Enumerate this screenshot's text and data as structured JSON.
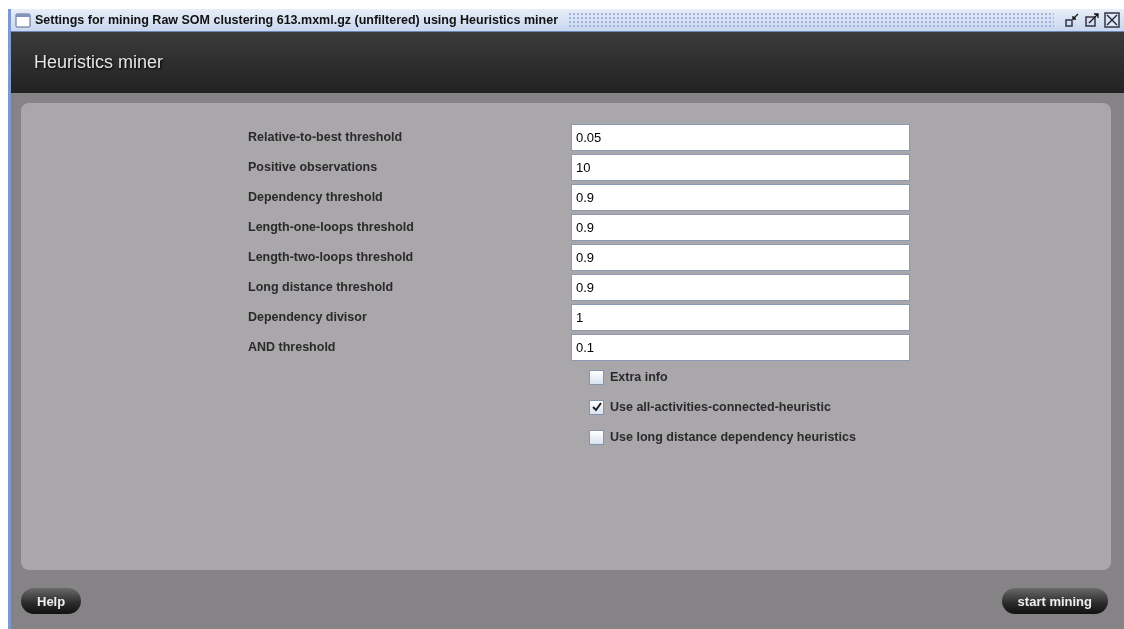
{
  "window": {
    "title": "Settings for mining Raw SOM clustering 613.mxml.gz (unfiltered) using Heuristics miner"
  },
  "header": {
    "title": "Heuristics miner"
  },
  "parameters": [
    {
      "label": "Relative-to-best threshold",
      "value": "0.05"
    },
    {
      "label": "Positive observations",
      "value": "10"
    },
    {
      "label": "Dependency threshold",
      "value": "0.9"
    },
    {
      "label": "Length-one-loops threshold",
      "value": "0.9"
    },
    {
      "label": "Length-two-loops threshold",
      "value": "0.9"
    },
    {
      "label": "Long distance threshold",
      "value": "0.9"
    },
    {
      "label": "Dependency divisor",
      "value": "1"
    },
    {
      "label": "AND threshold",
      "value": "0.1"
    }
  ],
  "options": [
    {
      "label": "Extra info",
      "checked": false
    },
    {
      "label": "Use all-activities-connected-heuristic",
      "checked": true
    },
    {
      "label": "Use long distance dependency heuristics",
      "checked": false
    }
  ],
  "buttons": [
    {
      "label": "Help"
    },
    {
      "label": "start mining"
    }
  ]
}
